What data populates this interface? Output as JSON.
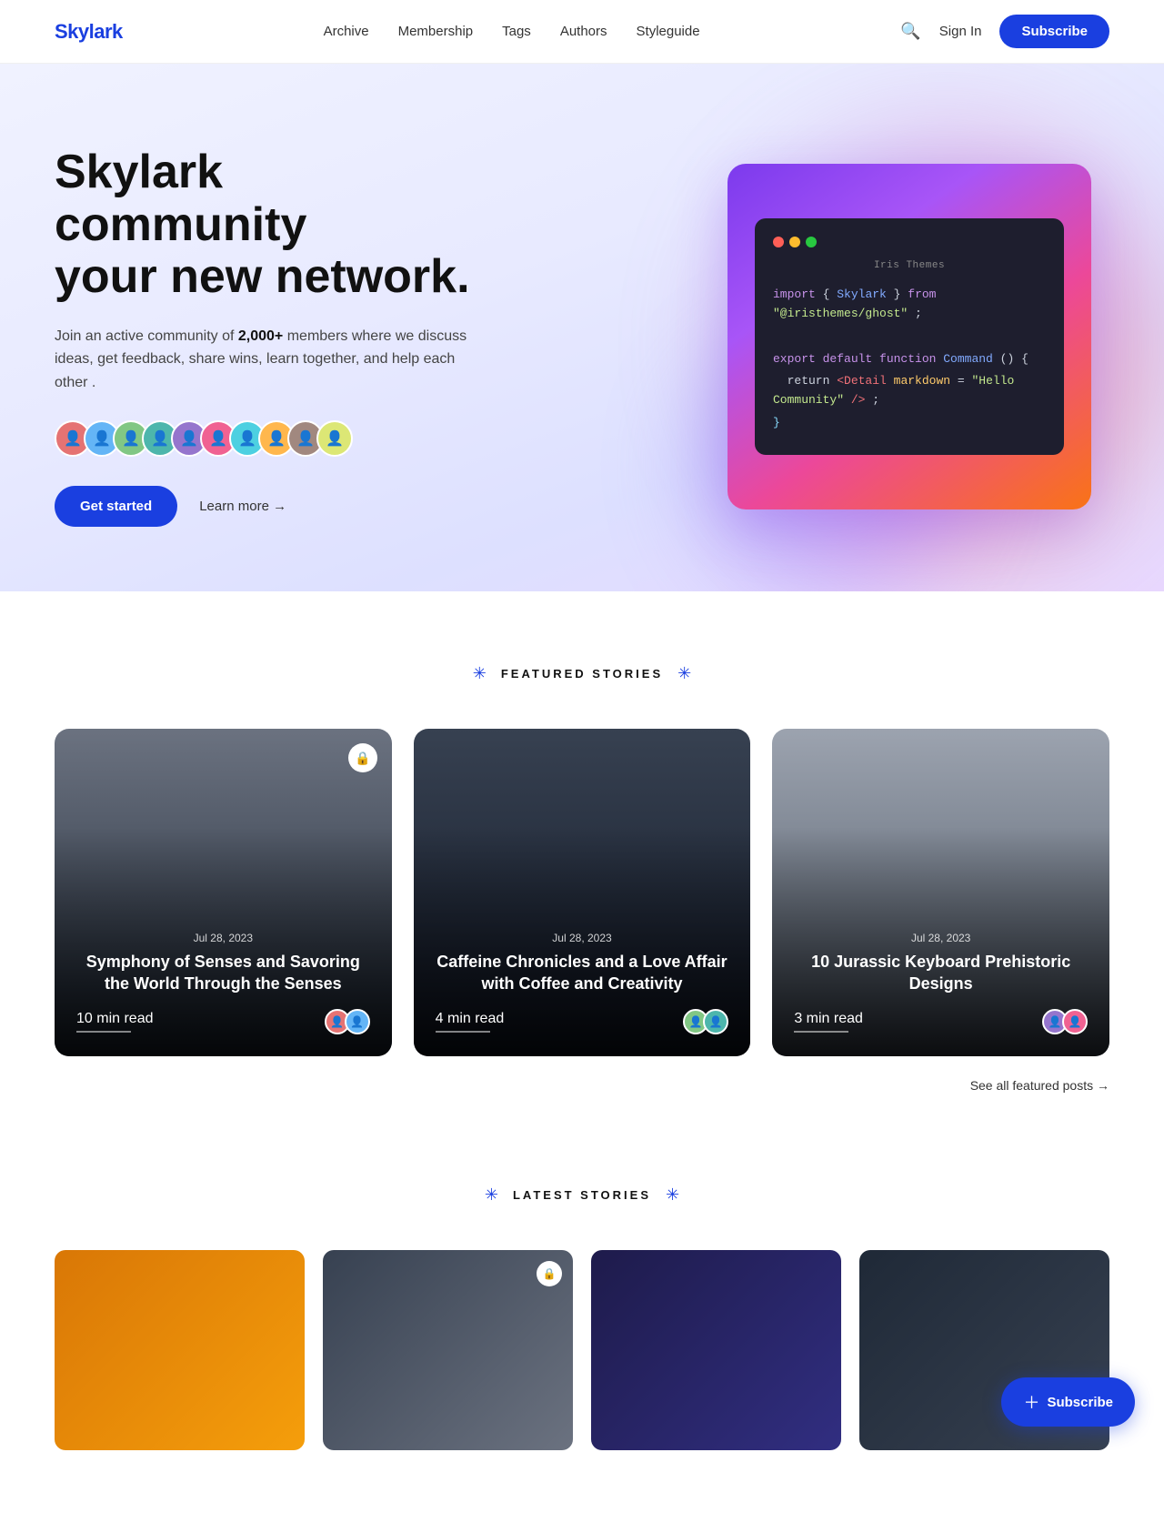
{
  "brand": {
    "name": "Skylark",
    "color": "#1a3fe0"
  },
  "nav": {
    "links": [
      {
        "label": "Archive",
        "href": "#"
      },
      {
        "label": "Membership",
        "href": "#"
      },
      {
        "label": "Tags",
        "href": "#"
      },
      {
        "label": "Authors",
        "href": "#"
      },
      {
        "label": "Styleguide",
        "href": "#"
      }
    ],
    "signin": "Sign In",
    "subscribe": "Subscribe"
  },
  "hero": {
    "title_line1": "Skylark community",
    "title_line2": "your new network.",
    "desc_prefix": "Join an active community of",
    "desc_highlight": "2,000+",
    "desc_suffix": "members where we discuss ideas, get feedback, share wins, learn together, and help each other .",
    "cta_primary": "Get started",
    "cta_secondary": "Learn more →",
    "code": {
      "window_title": "Iris Themes",
      "line1": "import { Skylark } from \"@iristhemes/ghost\";",
      "line2": "",
      "line3": "export default function Command() {",
      "line4": "  return <Detail markdown=\"Hello Community\" />;",
      "line5": "}"
    }
  },
  "featured": {
    "section_label": "FEATURED STORIES",
    "cards": [
      {
        "date": "Jul 28, 2023",
        "title": "Symphony of Senses and Savoring the World Through the Senses",
        "read_time": "10 min read",
        "locked": true,
        "bg_color": "#3a3a4a"
      },
      {
        "date": "Jul 28, 2023",
        "title": "Caffeine Chronicles and a Love Affair with Coffee and Creativity",
        "read_time": "4 min read",
        "locked": false,
        "bg_color": "#2a2a3a"
      },
      {
        "date": "Jul 28, 2023",
        "title": "10 Jurassic Keyboard Prehistoric Designs",
        "read_time": "3 min read",
        "locked": false,
        "bg_color": "#4a5a6a"
      }
    ],
    "see_all": "See all featured posts →"
  },
  "latest": {
    "section_label": "LATEST STORIES"
  },
  "fab": {
    "label": "Subscribe",
    "plus": "+"
  }
}
